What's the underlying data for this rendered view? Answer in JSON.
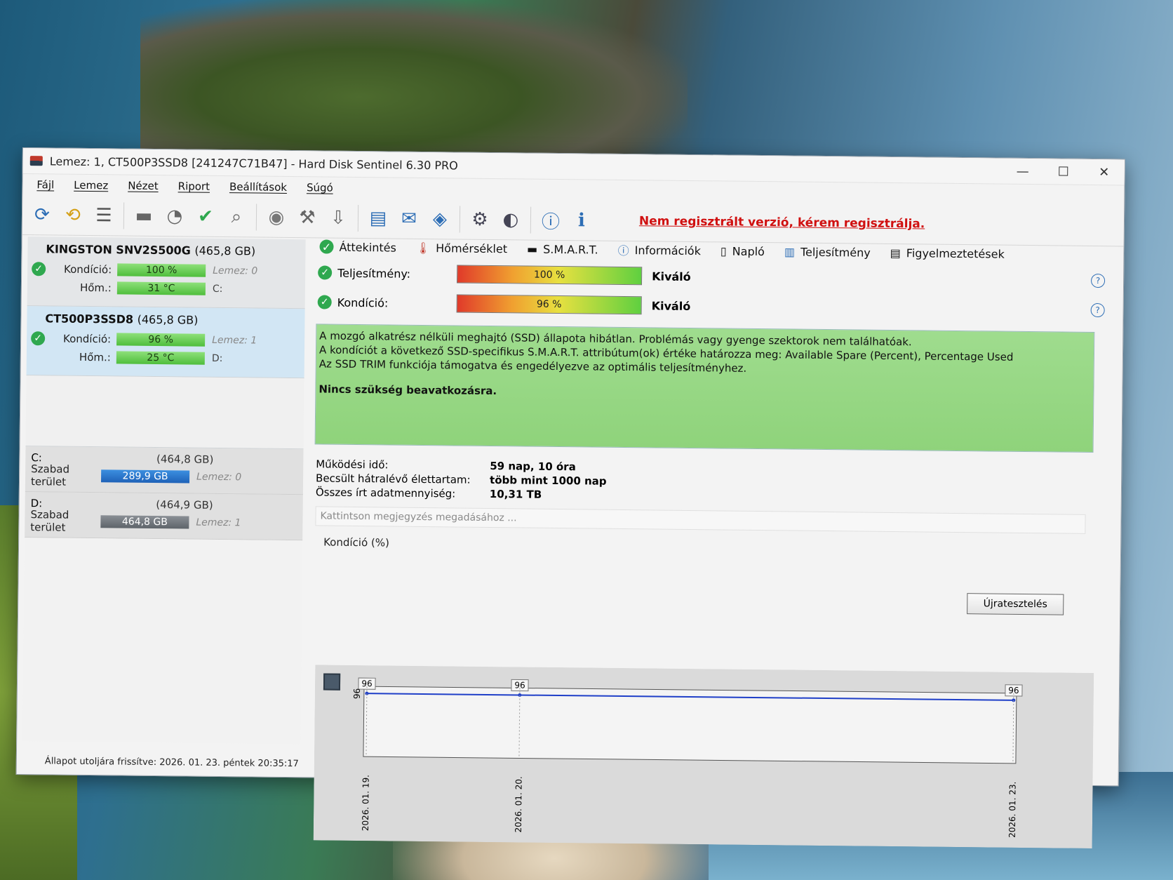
{
  "window": {
    "title": "Lemez: 1, CT500P3SSD8 [241247C71B47]  -  Hard Disk Sentinel 6.30 PRO",
    "minimize": "—",
    "maximize": "☐",
    "close": "✕"
  },
  "menu": [
    "Fájl",
    "Lemez",
    "Nézet",
    "Riport",
    "Beállítások",
    "Súgó"
  ],
  "toolbar": {
    "register_notice": "Nem regisztrált verzió, kérem regisztrálja."
  },
  "disks": [
    {
      "name": "KINGSTON SNV2S500G",
      "size": "(465,8 GB)",
      "health_label": "Kondíció:",
      "health": "100 %",
      "disk_index": "Lemez: 0",
      "temp_label": "Hőm.:",
      "temp": "31 °C",
      "drive_letter": "C:"
    },
    {
      "name": "CT500P3SSD8",
      "size": "(465,8 GB)",
      "health_label": "Kondíció:",
      "health": "96 %",
      "disk_index": "Lemez: 1",
      "temp_label": "Hőm.:",
      "temp": "25 °C",
      "drive_letter": "D:"
    }
  ],
  "partitions": [
    {
      "letter": "C:",
      "size": "(464,8 GB)",
      "free_label": "Szabad terület",
      "free": "289,9 GB",
      "disk": "Lemez: 0"
    },
    {
      "letter": "D:",
      "size": "(464,9 GB)",
      "free_label": "Szabad terület",
      "free": "464,8 GB",
      "disk": "Lemez: 1"
    }
  ],
  "tabs": [
    "Áttekintés",
    "Hőmérséklet",
    "S.M.A.R.T.",
    "Információk",
    "Napló",
    "Teljesítmény",
    "Figyelmeztetések"
  ],
  "metrics": {
    "performance_label": "Teljesítmény:",
    "performance_value": "100 %",
    "performance_verdict": "Kiváló",
    "health_label": "Kondíció:",
    "health_value": "96 %",
    "health_verdict": "Kiváló"
  },
  "status_text": {
    "line1": "A mozgó alkatrész nélküli meghajtó (SSD) állapota hibátlan. Problémás vagy gyenge szektorok nem találhatóak.",
    "line2": "A kondíciót a következő SSD-specifikus S.M.A.R.T. attribútum(ok) értéke határozza meg:  Available Spare (Percent), Percentage Used",
    "line3": "Az SSD TRIM funkciója támogatva és engedélyezve az optimális teljesítményhez.",
    "line4": "Nincs szükség beavatkozásra."
  },
  "info": {
    "uptime_label": "Működési idő:",
    "uptime_value": "59 nap, 10 óra",
    "lifetime_label": "Becsült hátralévő élettartam:",
    "lifetime_value": "több mint 1000 nap",
    "written_label": "Összes írt adatmennyiség:",
    "written_value": "10,31 TB"
  },
  "retest_button": "Újratesztelés",
  "note_placeholder": "Kattintson megjegyzés megadásához ...",
  "chart_data": {
    "type": "line",
    "title": "Kondíció  (%)",
    "x": [
      "2026. 01. 19.",
      "2026. 01. 20.",
      "2026. 01. 23."
    ],
    "values": [
      96,
      96,
      96
    ],
    "y_tick": "96",
    "color": "#1f3fc8"
  },
  "statusbar": "Állapot utoljára frissítve: 2026. 01. 23. péntek 20:35:17"
}
